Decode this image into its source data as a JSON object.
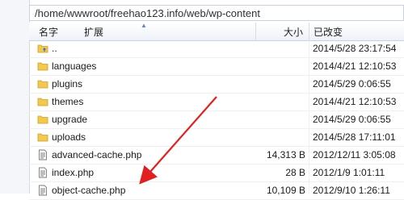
{
  "path": "/home/wwwroot/freehao123.info/web/wp-content",
  "columns": {
    "name": "名字",
    "ext": "扩展",
    "size": "大小",
    "modified": "已改变"
  },
  "rows": [
    {
      "name": "..",
      "size": "",
      "modified": "2014/5/28 23:17:54",
      "icon": "folder-up-icon"
    },
    {
      "name": "languages",
      "size": "",
      "modified": "2014/4/21 12:10:53",
      "icon": "folder-icon"
    },
    {
      "name": "plugins",
      "size": "",
      "modified": "2014/5/29 0:06:55",
      "icon": "folder-icon"
    },
    {
      "name": "themes",
      "size": "",
      "modified": "2014/4/21 12:10:53",
      "icon": "folder-icon"
    },
    {
      "name": "upgrade",
      "size": "",
      "modified": "2014/5/29 0:06:55",
      "icon": "folder-icon"
    },
    {
      "name": "uploads",
      "size": "",
      "modified": "2014/5/28 17:11:01",
      "icon": "folder-icon"
    },
    {
      "name": "advanced-cache.php",
      "size": "14,313 B",
      "modified": "2012/12/11 3:05:08",
      "icon": "php-file-icon"
    },
    {
      "name": "index.php",
      "size": "28 B",
      "modified": "2012/1/9 1:01:11",
      "icon": "php-file-icon"
    },
    {
      "name": "object-cache.php",
      "size": "10,109 B",
      "modified": "2012/9/10 1:26:11",
      "icon": "php-file-icon"
    }
  ],
  "colors": {
    "arrow": "#e02020",
    "folder": "#f2c94c",
    "header_bg": "#eef2f7"
  }
}
